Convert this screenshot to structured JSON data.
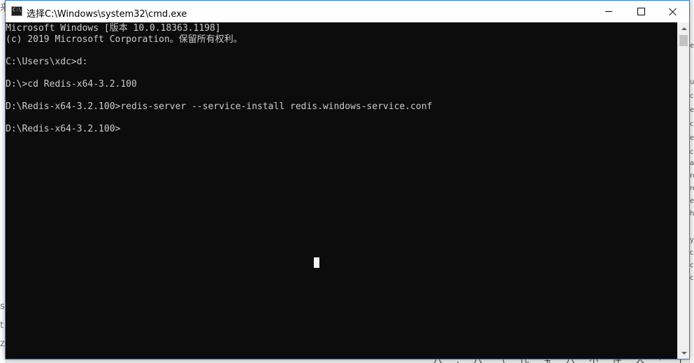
{
  "window": {
    "title": "选择C:\\Windows\\system32\\cmd.exe",
    "icon": "cmd-icon",
    "icon_glyph": "C:\\",
    "border_color": "#2b78d4"
  },
  "console": {
    "background": "#0c0c0c",
    "foreground": "#cccccc",
    "lines": [
      "Microsoft Windows [版本 10.0.18363.1198]",
      "(c) 2019 Microsoft Corporation。保留所有权利。",
      "",
      "C:\\Users\\xdc>d:",
      "",
      "D:\\>cd Redis-x64-3.2.100",
      "",
      "D:\\Redis-x64-3.2.100>redis-server --service-install redis.windows-service.conf",
      "",
      "D:\\Redis-x64-3.2.100>"
    ]
  },
  "background_windows": {
    "left_fragments": [
      "来",
      "s",
      "t",
      "z"
    ],
    "right_fragments": [
      "er",
      "uc",
      "co",
      "ev",
      "co",
      "ec",
      "co",
      "ac",
      "rc",
      "re",
      "eg",
      "ho",
      "y",
      "cl",
      "cc",
      "cc"
    ],
    "bottom_fragment": "八 . 八 （ 代 宝 八 小 件 人 · 丁 ㄙ 一 朋 、"
  }
}
